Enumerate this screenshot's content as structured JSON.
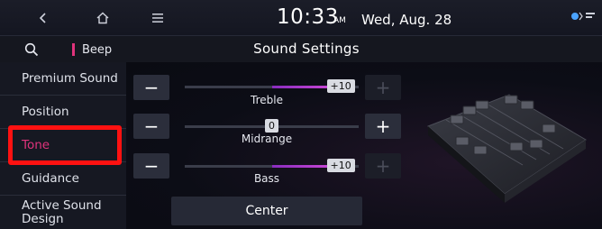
{
  "topbar": {
    "back_icon": "chevron-left-icon",
    "home_icon": "home-icon",
    "menu_icon": "hamburger-icon",
    "time": "10:33",
    "ampm": "AM",
    "date": "Wed, Aug. 28"
  },
  "subbar": {
    "search_icon": "search-icon",
    "beep_label": "Beep",
    "title": "Sound Settings"
  },
  "sidebar": {
    "items": [
      {
        "label": "Premium Sound"
      },
      {
        "label": "Position"
      },
      {
        "label": "Tone",
        "selected": true
      },
      {
        "label": "Guidance"
      },
      {
        "label": "Active Sound Design"
      }
    ]
  },
  "tone": {
    "treble": {
      "label": "Treble",
      "value": "+10",
      "level": 10,
      "min": -10,
      "max": 10
    },
    "midrange": {
      "label": "Midrange",
      "value": "0",
      "level": 0,
      "min": -10,
      "max": 10
    },
    "bass": {
      "label": "Bass",
      "value": "+10",
      "level": 10,
      "min": -10,
      "max": 10
    },
    "minus_symbol": "−",
    "plus_symbol": "+",
    "center_label": "Center"
  },
  "colors": {
    "accent": "#e0337c",
    "highlight_box": "#ff1111",
    "slider_fill": "#c23fd3"
  }
}
